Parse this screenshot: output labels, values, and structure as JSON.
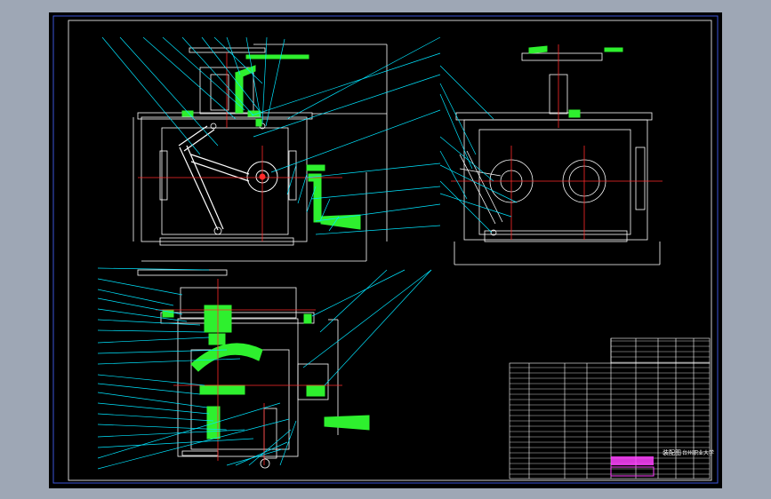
{
  "colors": {
    "background_outer": "#9ea7b5",
    "canvas": "#000000",
    "border_outer": "#3d55d8",
    "line": "#ffffff",
    "leader": "#00e5ff",
    "section_hatch": "#2ef02e",
    "center_line": "#ff2a2a",
    "titleblock_accent": "#ff40ff",
    "dim_text": "#ffffff"
  },
  "titleblock": {
    "drawing_title": "装配图",
    "school": "台州职业大学"
  }
}
